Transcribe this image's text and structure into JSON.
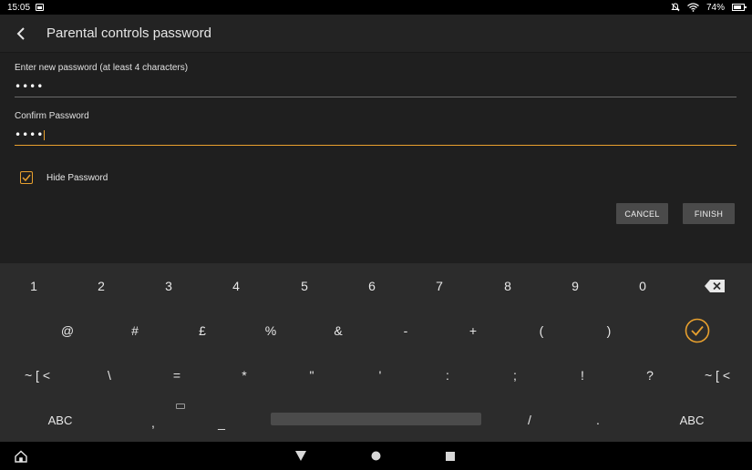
{
  "status_bar": {
    "time": "15:05",
    "battery": "74%"
  },
  "app_bar": {
    "title": "Parental controls password"
  },
  "form": {
    "new_password_label": "Enter new password (at least 4 characters)",
    "new_password_value": "••••",
    "confirm_password_label": "Confirm Password",
    "confirm_password_value": "••••",
    "hide_password_label": "Hide Password",
    "hide_password_checked": true
  },
  "buttons": {
    "cancel": "CANCEL",
    "finish": "FINISH"
  },
  "colors": {
    "accent": "#e8a02e",
    "background": "#1f1f1f",
    "keyboard": "#2c2c2c",
    "button": "#4a4a4a"
  },
  "keyboard": {
    "row1": [
      "1",
      "2",
      "3",
      "4",
      "5",
      "6",
      "7",
      "8",
      "9",
      "0"
    ],
    "row2": [
      "@",
      "#",
      "£",
      "%",
      "&",
      "-",
      "+",
      "(",
      ")"
    ],
    "row3": [
      "~ [ <",
      "\\",
      "=",
      "*",
      "\"",
      "'",
      ":",
      ";",
      "!",
      "?",
      "~ [ <"
    ],
    "row4": [
      "ABC",
      ",",
      "_",
      "/",
      ".",
      "ABC"
    ]
  }
}
